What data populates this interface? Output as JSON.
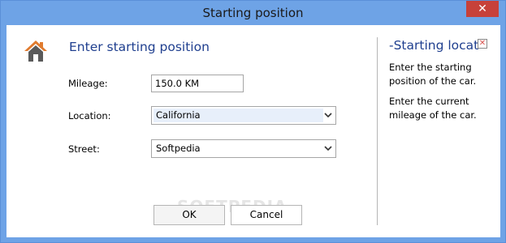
{
  "window": {
    "title": "Starting position",
    "close_glyph": "✕"
  },
  "heading": "Enter starting position",
  "form": {
    "mileage_label": "Mileage:",
    "mileage_value": "150.0 KM",
    "location_label": "Location:",
    "location_value": "California",
    "street_label": "Street:",
    "street_value": "Softpedia"
  },
  "side_panel": {
    "title": "-Starting location",
    "close_glyph": "✕",
    "text1": "Enter the starting position of the car.",
    "text2": "Enter the current mileage of the car."
  },
  "buttons": {
    "ok": "OK",
    "cancel": "Cancel"
  },
  "watermark": "SOFTPEDIA",
  "colors": {
    "titlebar": "#6ea3e6",
    "close_button": "#c7413a",
    "heading": "#1f3f8f",
    "house_roof": "#e07b2f",
    "house_body": "#5a5a5a"
  }
}
